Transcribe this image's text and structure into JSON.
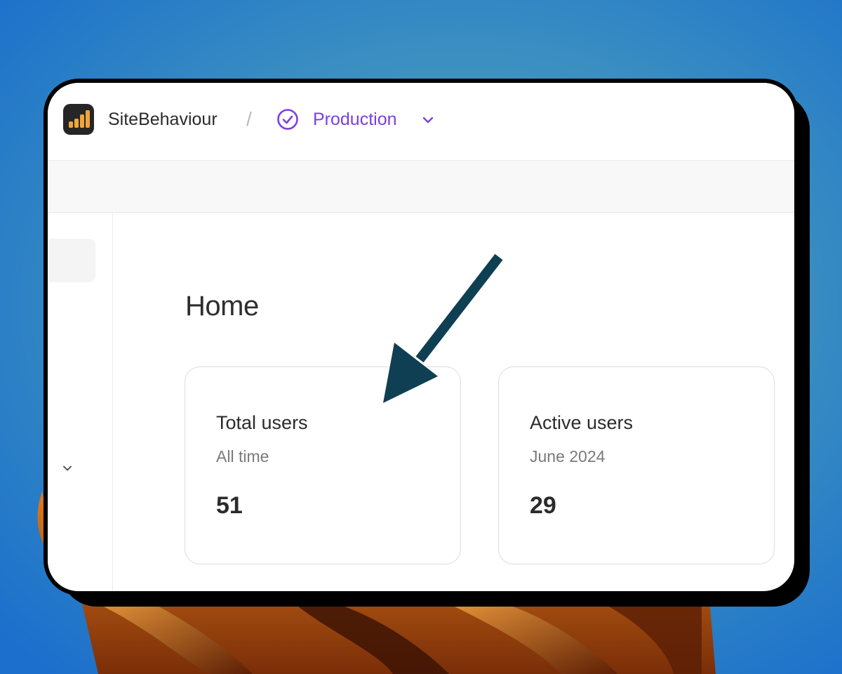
{
  "header": {
    "brand": "SiteBehaviour",
    "separator": "/",
    "environment": "Production",
    "logo_icon": "bar-chart-icon",
    "environment_icon": "check-circle-icon",
    "dropdown_icon": "chevron-down-icon"
  },
  "page": {
    "title": "Home"
  },
  "cards": [
    {
      "title": "Total users",
      "subtitle": "All time",
      "value": "51"
    },
    {
      "title": "Active users",
      "subtitle": "June 2024",
      "value": "29"
    }
  ],
  "colors": {
    "accent": "#7b3fe4",
    "arrow": "#0f3f52",
    "logo_bars": "#f0a63a"
  }
}
